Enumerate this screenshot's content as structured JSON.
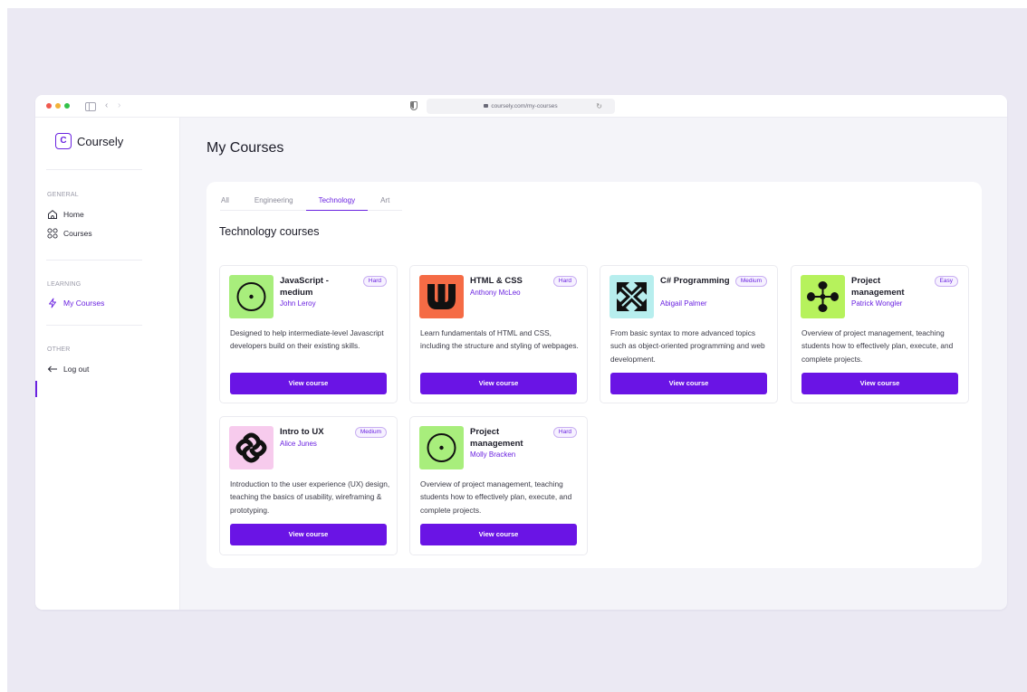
{
  "browser": {
    "url": "coursely.com/my-courses"
  },
  "sidebar": {
    "brand_letter": "C",
    "brand_name": "Coursely",
    "sections": [
      {
        "label": "GENERAL",
        "items": [
          {
            "label": "Home",
            "icon": "home-icon"
          },
          {
            "label": "Courses",
            "icon": "grid-icon"
          }
        ]
      },
      {
        "label": "LEARNING",
        "items": [
          {
            "label": "My Courses",
            "icon": "lightning-icon",
            "active": true
          }
        ]
      },
      {
        "label": "OTHER",
        "items": [
          {
            "label": "Log out",
            "icon": "arrow-left-icon"
          }
        ]
      }
    ]
  },
  "main": {
    "title": "My Courses",
    "tabs": [
      "All",
      "Engineering",
      "Technology",
      "Art"
    ],
    "active_tab": "Technology",
    "section_title": "Technology courses"
  },
  "courses": [
    {
      "title": "JavaScript - medium",
      "author": "John Leroy",
      "difficulty": "Hard",
      "description": "Designed to help intermediate-level Javascript developers build on their existing skills.",
      "button": "View course",
      "thumb_color": "#a8ee7c",
      "icon": "circle-dot-icon"
    },
    {
      "title": "HTML & CSS",
      "author": "Anthony McLeo",
      "difficulty": "Hard",
      "description": "Learn fundamentals of HTML and CSS, including the structure and styling of webpages.",
      "button": "View course",
      "thumb_color": "#f56b45",
      "icon": "w-logo-icon"
    },
    {
      "title": "C# Programming",
      "author": "Abigail Palmer",
      "difficulty": "Medium",
      "description": "From basic syntax to more advanced topics such as object-oriented programming and web development.",
      "button": "View course",
      "thumb_color": "#b7eeee",
      "icon": "arrows-x-icon"
    },
    {
      "title": "Project management",
      "author": "Patrick Wongler",
      "difficulty": "Easy",
      "description": "Overview of project management, teaching students how to effectively plan, execute, and complete projects.",
      "button": "View course",
      "thumb_color": "#b6f25c",
      "icon": "cross-dots-icon"
    },
    {
      "title": "Intro to UX",
      "author": "Alice Junes",
      "difficulty": "Medium",
      "description": "Introduction to the user experience (UX) design, teaching the basics of usability, wireframing & prototyping.",
      "button": "View course",
      "thumb_color": "#f7cbed",
      "icon": "knot-icon"
    },
    {
      "title": "Project management",
      "author": "Molly Bracken",
      "difficulty": "Hard",
      "description": "Overview of project management, teaching students how to effectively plan, execute, and complete projects.",
      "button": "View course",
      "thumb_color": "#a8ee7c",
      "icon": "circle-dot-icon"
    }
  ],
  "colors": {
    "accent": "#6a14e5",
    "background": "#ebe9f3"
  }
}
